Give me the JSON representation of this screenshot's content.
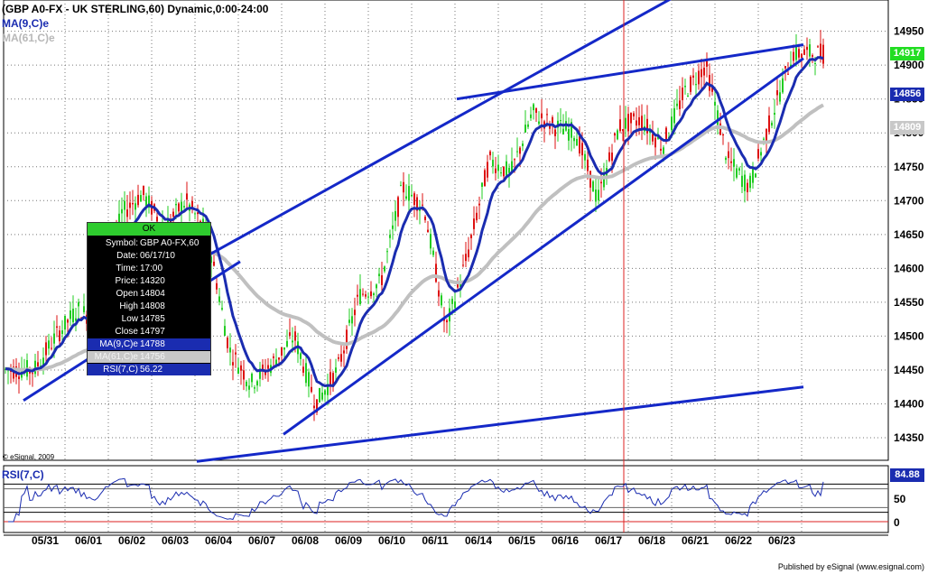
{
  "header": {
    "title": "(GBP A0-FX - UK STERLING,60) Dynamic,0:00-24:00",
    "ma9_label": "MA(9,C)e",
    "ma61_label": "MA(61,C)e"
  },
  "rsi_label": "RSI(7,C)",
  "copyright": "© eSignal, 2009",
  "published": "Published by eSignal (www.esignal.com)",
  "colors": {
    "up": "#22cc22",
    "down": "#dd1111",
    "ma9": "#1a2cb0",
    "ma61": "#c0c0c0",
    "trend": "#1428c8",
    "vline": "#dd2222",
    "grid": "#777777",
    "last_tag": "#22dd22"
  },
  "data_box": {
    "button": "OK",
    "symbol_label": "Symbol:",
    "symbol": "GBP A0-FX,60",
    "date_label": "Date:",
    "date": "06/17/10",
    "time_label": "Time:",
    "time": "17:00",
    "price_label": "Price:",
    "price": "14320",
    "open_label": "Open",
    "open": "14804",
    "high_label": "High",
    "high": "14808",
    "low_label": "Low",
    "low": "14785",
    "close_label": "Close",
    "close": "14797",
    "ma9_label": "MA(9,C)e",
    "ma9": "14788",
    "ma61_label": "MA(61,C)e",
    "ma61": "14756",
    "rsi_label": "RSI(7,C)",
    "rsi": "56.22"
  },
  "price_tags": {
    "last": "14917",
    "ma9": "14856",
    "ma61": "14809",
    "rsi": "84.88"
  },
  "chart_data": [
    {
      "type": "candlestick",
      "title": "(GBP A0-FX - UK STERLING,60) Dynamic,0:00-24:00",
      "interval": "60 minutes",
      "ylim": [
        14310,
        15000
      ],
      "yticks": [
        14350,
        14400,
        14450,
        14500,
        14550,
        14600,
        14650,
        14700,
        14750,
        14800,
        14850,
        14900,
        14950
      ],
      "x_categories": [
        "05/31",
        "06/01",
        "06/02",
        "06/03",
        "06/04",
        "06/07",
        "06/08",
        "06/09",
        "06/10",
        "06/11",
        "06/14",
        "06/15",
        "06/16",
        "06/17",
        "06/18",
        "06/21",
        "06/22",
        "06/23"
      ],
      "grid": true,
      "close_path": [
        [
          "05/31",
          14450
        ],
        [
          "05/31",
          14500
        ],
        [
          "06/01",
          14540
        ],
        [
          "06/01",
          14520
        ],
        [
          "06/02",
          14680
        ],
        [
          "06/02",
          14710
        ],
        [
          "06/03",
          14660
        ],
        [
          "06/03",
          14700
        ],
        [
          "06/04",
          14650
        ],
        [
          "06/04",
          14480
        ],
        [
          "06/07",
          14430
        ],
        [
          "06/07",
          14460
        ],
        [
          "06/08",
          14500
        ],
        [
          "06/08",
          14400
        ],
        [
          "06/09",
          14450
        ],
        [
          "06/09",
          14560
        ],
        [
          "06/10",
          14580
        ],
        [
          "06/10",
          14720
        ],
        [
          "06/11",
          14690
        ],
        [
          "06/11",
          14510
        ],
        [
          "06/14",
          14620
        ],
        [
          "06/14",
          14760
        ],
        [
          "06/15",
          14740
        ],
        [
          "06/15",
          14830
        ],
        [
          "06/16",
          14810
        ],
        [
          "06/16",
          14800
        ],
        [
          "06/17",
          14700
        ],
        [
          "06/17",
          14810
        ],
        [
          "06/18",
          14820
        ],
        [
          "06/18",
          14780
        ],
        [
          "06/21",
          14860
        ],
        [
          "06/21",
          14900
        ],
        [
          "06/22",
          14760
        ],
        [
          "06/22",
          14720
        ],
        [
          "06/23",
          14820
        ],
        [
          "06/23",
          14917
        ]
      ],
      "series": [
        {
          "name": "MA(9,C)e",
          "last": 14856
        },
        {
          "name": "MA(61,C)e",
          "last": 14809
        }
      ],
      "last_price": 14917,
      "trendlines": [
        {
          "from": [
            "05/31",
            14405
          ],
          "to": [
            "06/04",
            14610
          ]
        },
        {
          "from": [
            "06/04",
            14610
          ],
          "to": [
            "06/18",
            15000
          ]
        },
        {
          "from": [
            "06/08",
            14355
          ],
          "to": [
            "06/23",
            14910
          ]
        },
        {
          "from": [
            "06/14",
            14850
          ],
          "to": [
            "06/23",
            14930
          ]
        },
        {
          "from": [
            "06/04",
            14315
          ],
          "to": [
            "06/23",
            14425
          ]
        }
      ],
      "cursor_line": "06/17"
    },
    {
      "type": "line",
      "title": "RSI(7,C)",
      "ylim": [
        0,
        100
      ],
      "yticks": [
        0,
        50
      ],
      "levels": [
        20,
        30,
        70,
        80
      ],
      "last": 84.88
    }
  ]
}
